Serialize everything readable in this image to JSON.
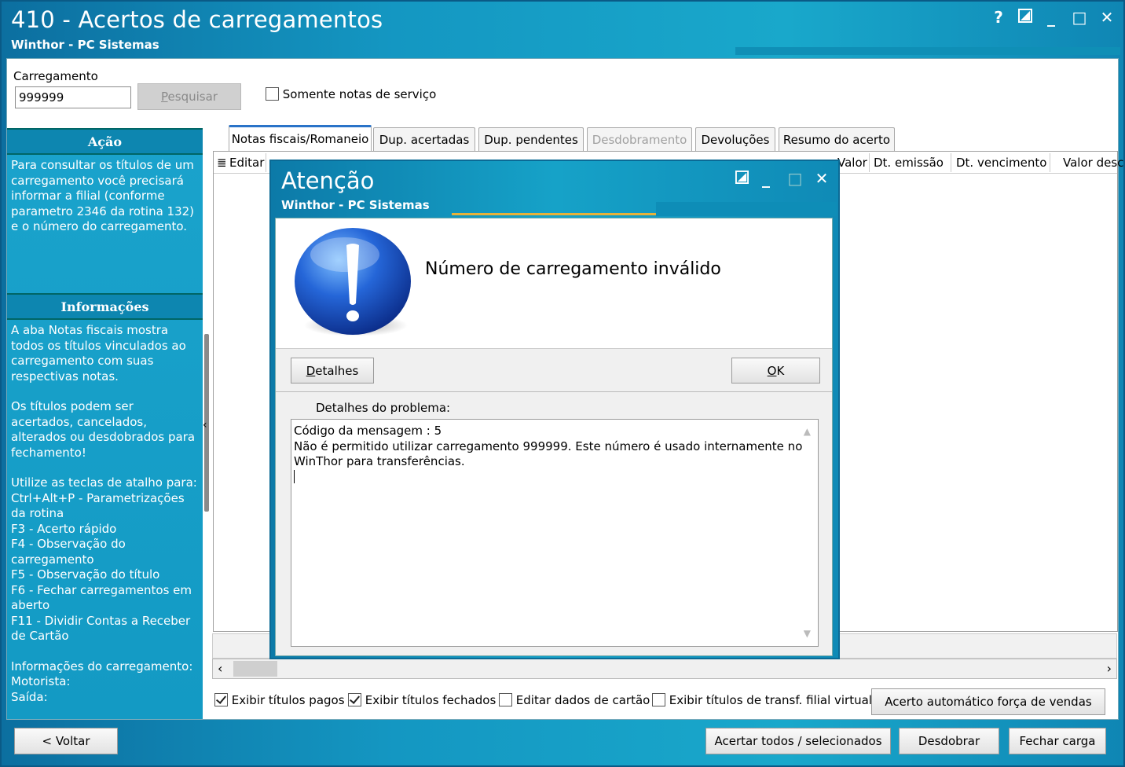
{
  "window": {
    "title": "410 - Acertos de carregamentos",
    "subtitle": "Winthor - PC Sistemas",
    "help": "?",
    "minimize": "_",
    "maximize": "□",
    "close": "✕"
  },
  "search": {
    "label": "Carregamento",
    "value": "999999",
    "button_first": "P",
    "button_rest": "esquisar",
    "somente_label": "Somente notas de serviço"
  },
  "left_panel": {
    "acao_title": "Ação",
    "acao_text": "Para consultar os títulos de um carregamento você precisará informar a filial (conforme parametro 2346 da rotina 132) e o número do carregamento.",
    "info_title": "Informações",
    "info_p1": "A aba Notas fiscais mostra todos os títulos vinculados ao carregamento com suas respectivas notas.",
    "info_p2": "Os títulos podem ser acertados, cancelados, alterados ou desdobrados para fechamento!",
    "shortcuts_title": "Utilize as teclas de atalho para:",
    "shortcuts": [
      "Ctrl+Alt+P - Parametrizações da rotina",
      "F3 - Acerto rápido",
      "F4 - Observação do carregamento",
      "F5 - Observação do título",
      "F6 - Fechar carregamentos em aberto",
      "F11 - Dividir Contas a Receber de Cartão"
    ],
    "carga_title": "Informações do carregamento:",
    "motorista": "Motorista:",
    "saida": "Saída:"
  },
  "tabs": [
    {
      "label": "Notas fiscais/Romaneio"
    },
    {
      "label": "Dup. acertadas"
    },
    {
      "label": "Dup. pendentes"
    },
    {
      "label": "Desdobramento"
    },
    {
      "label": "Devoluções"
    },
    {
      "label": "Resumo do acerto"
    }
  ],
  "grid": {
    "columns": [
      "Editar",
      "Valor",
      "Dt. emissão",
      "Dt. vencimento",
      "Valor desc"
    ]
  },
  "options": {
    "exibir_pagos": "Exibir títulos pagos",
    "exibir_fechados": "Exibir títulos fechados",
    "editar_cartao": "Editar dados de cartão",
    "exibir_transf": "Exibir títulos de transf. filial virtual",
    "acerto_auto": "Acerto automático força de vendas"
  },
  "bottom": {
    "voltar": "< Voltar",
    "acertar": "Acertar todos / selecionados",
    "desdobrar": "Desdobrar",
    "fechar": "Fechar carga"
  },
  "dialog": {
    "title": "Atenção",
    "subtitle": "Winthor - PC Sistemas",
    "message": "Número de carregamento inválido",
    "detalhes_first": "D",
    "detalhes_rest": "etalhes",
    "ok_first": "O",
    "ok_rest": "K",
    "details_label": "Detalhes do problema:",
    "details_line1": "Código da mensagem : 5",
    "details_line2": "Não é permitido utilizar carregamento 999999. Este número é usado internamente no",
    "details_line3": "WinThor para transferências."
  },
  "colors": {
    "title_bar": "#1497c2",
    "panel": "#1aa3cc",
    "active_tab": "#2a73c8"
  }
}
